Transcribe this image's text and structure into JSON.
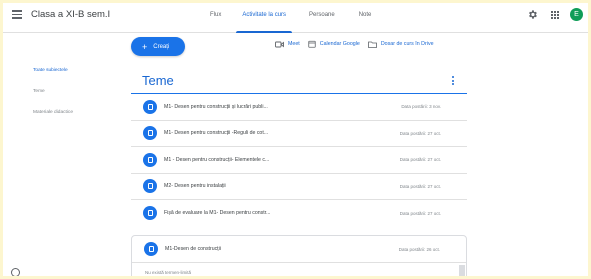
{
  "header": {
    "class_title": "Clasa a XI-B sem.I",
    "tabs": [
      "Flux",
      "Activitate la curs",
      "Persoane",
      "Note"
    ],
    "active_tab": 1,
    "avatar_letter": "E",
    "avatar_color": "#0f9d58"
  },
  "toolbar": {
    "create_label": "Creați",
    "meet_label": "Meet",
    "calendar_label": "Calendar Google",
    "drive_label": "Dosar de curs în Drive"
  },
  "sidenav": {
    "items": [
      "Toate subiectele",
      "Teme",
      "Materiale didactice"
    ],
    "active_index": 0
  },
  "topic": {
    "title": "Teme"
  },
  "assignments": [
    {
      "title": "M1- Desen pentru construcții și lucrări publi...",
      "meta": "Data postării: 3 nov."
    },
    {
      "title": "M1- Desen pentru construcții -Reguli de cot...",
      "meta": "Data postării: 27 oct."
    },
    {
      "title": "M1 - Desen pentru construcții- Elementele c...",
      "meta": "Data postării: 27 oct."
    },
    {
      "title": "M2- Desen pentru instalații",
      "meta": "Data postării: 27 oct."
    },
    {
      "title": "Fișă de evaluare la M1- Desen pentru constr...",
      "meta": "Data postării: 27 oct."
    }
  ],
  "expanded_assignment": {
    "title": "M1-Desen de construcții",
    "meta": "Data postării: 26 oct.",
    "note": "Nu există termen-limită"
  },
  "colors": {
    "accent": "#1a73e8",
    "accent_text": "#1967d2"
  }
}
